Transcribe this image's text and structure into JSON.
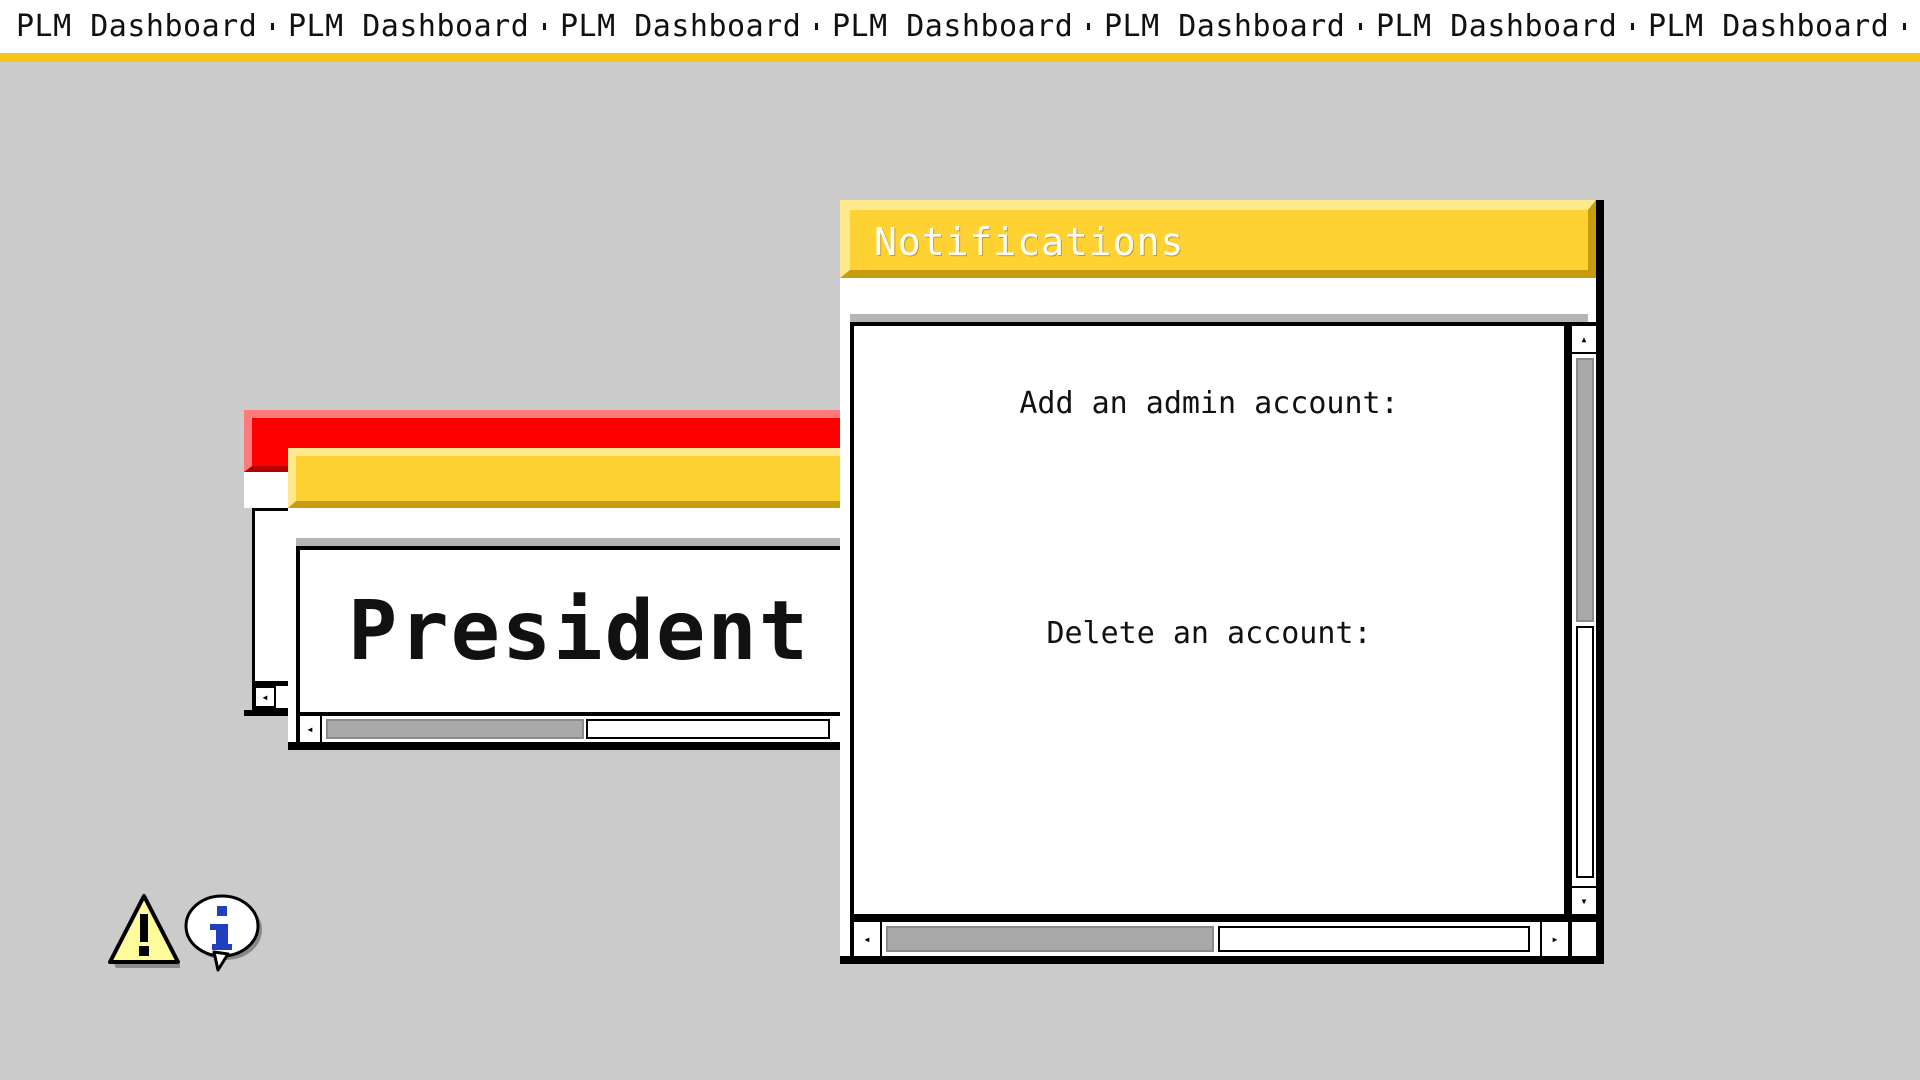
{
  "topbar": {
    "items": [
      "PLM Dashboard",
      "PLM Dashboard",
      "PLM Dashboard",
      "PLM Dashboard",
      "PLM Dashboard",
      "PLM Dashboard",
      "PLM Dashboard"
    ]
  },
  "colors": {
    "accent_yellow": "#fed233",
    "alert_red": "#ff0000",
    "desktop": "#cbcbcb"
  },
  "notifications_window": {
    "title": "Notifications",
    "line1": "Add an admin account:",
    "line2": "Delete an account:"
  },
  "president_window": {
    "text": "President"
  },
  "desktop_icons": [
    "warning-icon",
    "info-icon"
  ]
}
